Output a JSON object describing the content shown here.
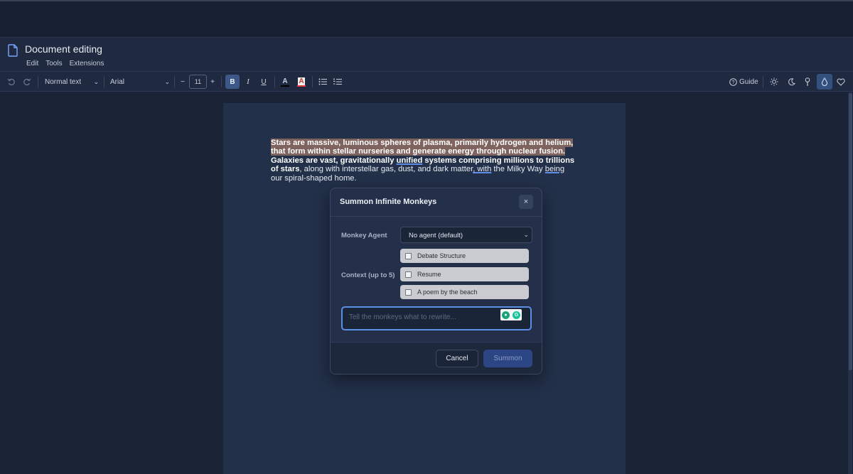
{
  "app": {
    "title": "Document editing",
    "menu": [
      "Edit",
      "Tools",
      "Extensions"
    ]
  },
  "toolbar": {
    "undo_icon": "undo-icon",
    "redo_icon": "redo-icon",
    "style_select": "Normal text",
    "font_select": "Arial",
    "font_size": "11",
    "decrease_label": "−",
    "increase_label": "+",
    "bold_label": "B",
    "italic_label": "I",
    "underline_label": "U",
    "text_color_label": "A",
    "highlight_label": "A",
    "guide_label": "Guide",
    "theme_icons": [
      "sun-icon",
      "moon-icon",
      "ice-cream-icon",
      "drop-icon",
      "heart-icon"
    ]
  },
  "document": {
    "highlighted_text": "Stars are massive, luminous spheres of plasma, primarily hydrogen and helium, that form within stellar nurseries and generate energy through nuclear fusion.",
    "bold_text_1": " Galaxies are vast, gravitationally ",
    "bold_underlined": "unified",
    "bold_text_2": " systems comprising millions to trillions of stars",
    "plain_text_1": ", along with interstellar gas, dust, and dark matter",
    "underlined_1": ", with",
    "plain_text_2": " the Milky Way ",
    "underlined_2": "being",
    "plain_text_3": " our spiral-shaped home."
  },
  "dialog": {
    "title": "Summon Infinite Monkeys",
    "close_label": "×",
    "agent_label": "Monkey Agent",
    "agent_value": "No agent (default)",
    "context_label": "Context (up to 5)",
    "context_items": [
      "Debate Structure",
      "Resume",
      "A poem by the beach"
    ],
    "prompt_placeholder": "Tell the monkeys what to rewrite...",
    "cancel_label": "Cancel",
    "summon_label": "Summon"
  },
  "colors": {
    "accent": "#5b8fe6",
    "highlight": "#7f635f",
    "summon_button": "#2c4685"
  }
}
